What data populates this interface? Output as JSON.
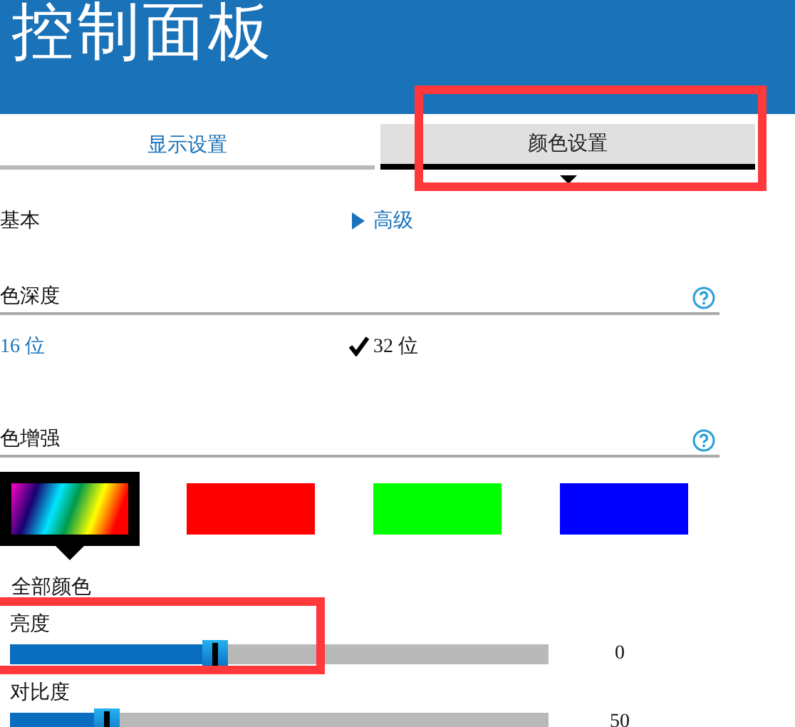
{
  "header": {
    "title": "控制面板"
  },
  "tabs": [
    {
      "label": "显示设置",
      "selected": false,
      "highlighted": false
    },
    {
      "label": "颜色设置",
      "selected": true,
      "highlighted": true
    }
  ],
  "modes": [
    {
      "label": "基本",
      "selected": true
    },
    {
      "label": "高级",
      "selected": false
    }
  ],
  "color_depth": {
    "title": "色深度",
    "options": [
      {
        "label": "16 位",
        "selected": false
      },
      {
        "label": "32 位",
        "selected": true
      }
    ]
  },
  "color_enhancement": {
    "title": "色增强",
    "swatches": [
      {
        "kind": "gradient",
        "selected": true
      },
      {
        "kind": "solid",
        "color": "#ff0000",
        "selected": false
      },
      {
        "kind": "solid",
        "color": "#00ff00",
        "selected": false
      },
      {
        "kind": "solid",
        "color": "#0000ff",
        "selected": false
      }
    ],
    "swatch_label": "全部颜色"
  },
  "sliders": [
    {
      "name": "亮度",
      "level": 0.38,
      "reading": "0",
      "highlighted": true
    },
    {
      "name": "对比度",
      "level": 0.18,
      "reading": "50",
      "highlighted": false
    }
  ]
}
